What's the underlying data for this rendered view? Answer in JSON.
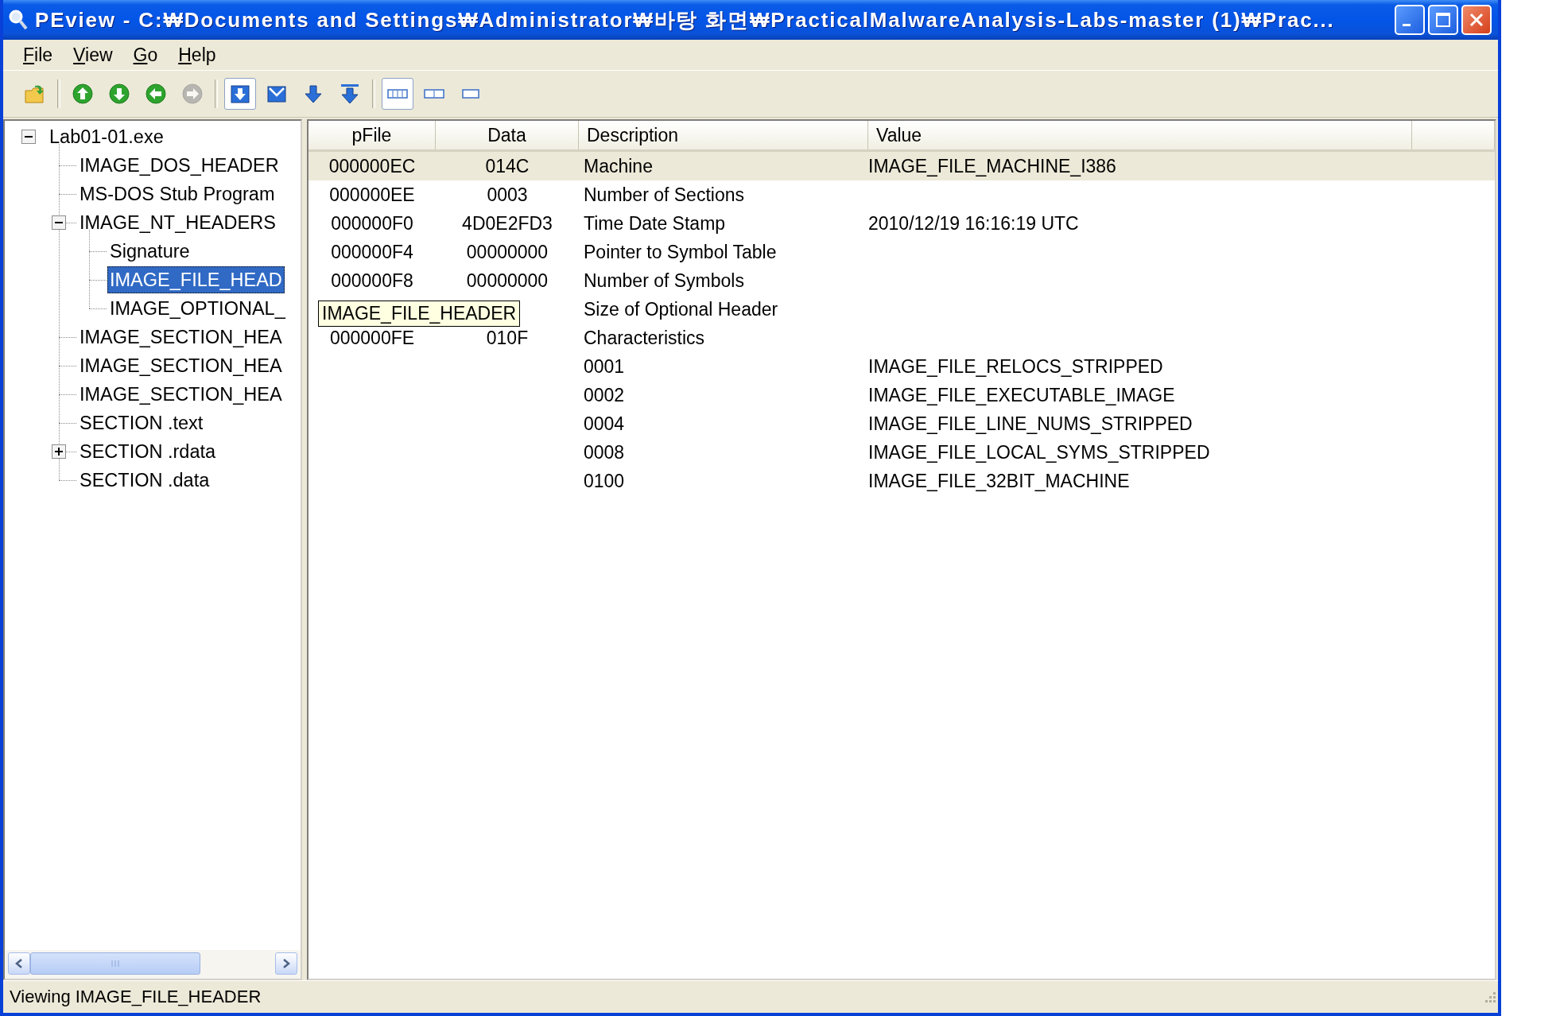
{
  "window": {
    "title": "PEview - C:₩Documents and Settings₩Administrator₩바탕 화면₩PracticalMalwareAnalysis-Labs-master (1)₩Prac..."
  },
  "menu": [
    "File",
    "View",
    "Go",
    "Help"
  ],
  "toolbar_groups": [
    [
      {
        "kind": "open",
        "pressed": false,
        "disabled": false
      }
    ],
    [
      {
        "kind": "up",
        "pressed": false,
        "disabled": false
      },
      {
        "kind": "down",
        "pressed": false,
        "disabled": false
      },
      {
        "kind": "back",
        "pressed": false,
        "disabled": false
      },
      {
        "kind": "forward",
        "pressed": false,
        "disabled": true
      }
    ],
    [
      {
        "kind": "header",
        "pressed": true,
        "disabled": false
      },
      {
        "kind": "section",
        "pressed": false,
        "disabled": false
      },
      {
        "kind": "next",
        "pressed": false,
        "disabled": false
      },
      {
        "kind": "last",
        "pressed": false,
        "disabled": false
      }
    ],
    [
      {
        "kind": "wide",
        "pressed": true,
        "disabled": false
      },
      {
        "kind": "half",
        "pressed": false,
        "disabled": false
      },
      {
        "kind": "narrow",
        "pressed": false,
        "disabled": false
      }
    ]
  ],
  "tree": {
    "label": "Lab01-01.exe",
    "expanded": true,
    "selected": false,
    "children": [
      {
        "label": "IMAGE_DOS_HEADER",
        "selected": false
      },
      {
        "label": "MS-DOS Stub Program",
        "selected": false
      },
      {
        "label": "IMAGE_NT_HEADERS",
        "expanded": true,
        "selected": false,
        "children": [
          {
            "label": "Signature",
            "selected": false
          },
          {
            "label": "IMAGE_FILE_HEAD",
            "selected": true
          },
          {
            "label": "IMAGE_OPTIONAL_",
            "selected": false
          }
        ]
      },
      {
        "label": "IMAGE_SECTION_HEA",
        "selected": false
      },
      {
        "label": "IMAGE_SECTION_HEA",
        "selected": false
      },
      {
        "label": "IMAGE_SECTION_HEA",
        "selected": false
      },
      {
        "label": "SECTION .text",
        "selected": false
      },
      {
        "label": "SECTION .rdata",
        "expanded": false,
        "selected": false
      },
      {
        "label": "SECTION .data",
        "selected": false
      }
    ]
  },
  "table": {
    "columns": [
      "pFile",
      "Data",
      "Description",
      "Value"
    ],
    "rows": [
      {
        "pfile": "000000EC",
        "data": "014C",
        "description": "Machine",
        "value": "IMAGE_FILE_MACHINE_I386",
        "selected": true
      },
      {
        "pfile": "000000EE",
        "data": "0003",
        "description": "Number of Sections",
        "selected": false
      },
      {
        "pfile": "000000F0",
        "data": "4D0E2FD3",
        "description": "Time Date Stamp",
        "value": "2010/12/19  16:16:19 UTC",
        "selected": false
      },
      {
        "pfile": "000000F4",
        "data": "00000000",
        "description": "Pointer to Symbol Table",
        "selected": false
      },
      {
        "pfile": "000000F8",
        "data": "00000000",
        "description": "Number of Symbols",
        "selected": false
      },
      {
        "description": "Size of Optional Header",
        "selected": false
      },
      {
        "pfile": "000000FE",
        "data": "010F",
        "description": "Characteristics",
        "selected": false
      },
      {
        "description": "0001",
        "value": "IMAGE_FILE_RELOCS_STRIPPED",
        "selected": false
      },
      {
        "description": "0002",
        "value": "IMAGE_FILE_EXECUTABLE_IMAGE",
        "selected": false
      },
      {
        "description": "0004",
        "value": "IMAGE_FILE_LINE_NUMS_STRIPPED",
        "selected": false
      },
      {
        "description": "0008",
        "value": "IMAGE_FILE_LOCAL_SYMS_STRIPPED",
        "selected": false
      },
      {
        "description": "0100",
        "value": "IMAGE_FILE_32BIT_MACHINE",
        "selected": false
      }
    ]
  },
  "tooltip": {
    "text": "IMAGE_FILE_HEADER"
  },
  "status_bar": {
    "text": "Viewing IMAGE_FILE_HEADER"
  }
}
